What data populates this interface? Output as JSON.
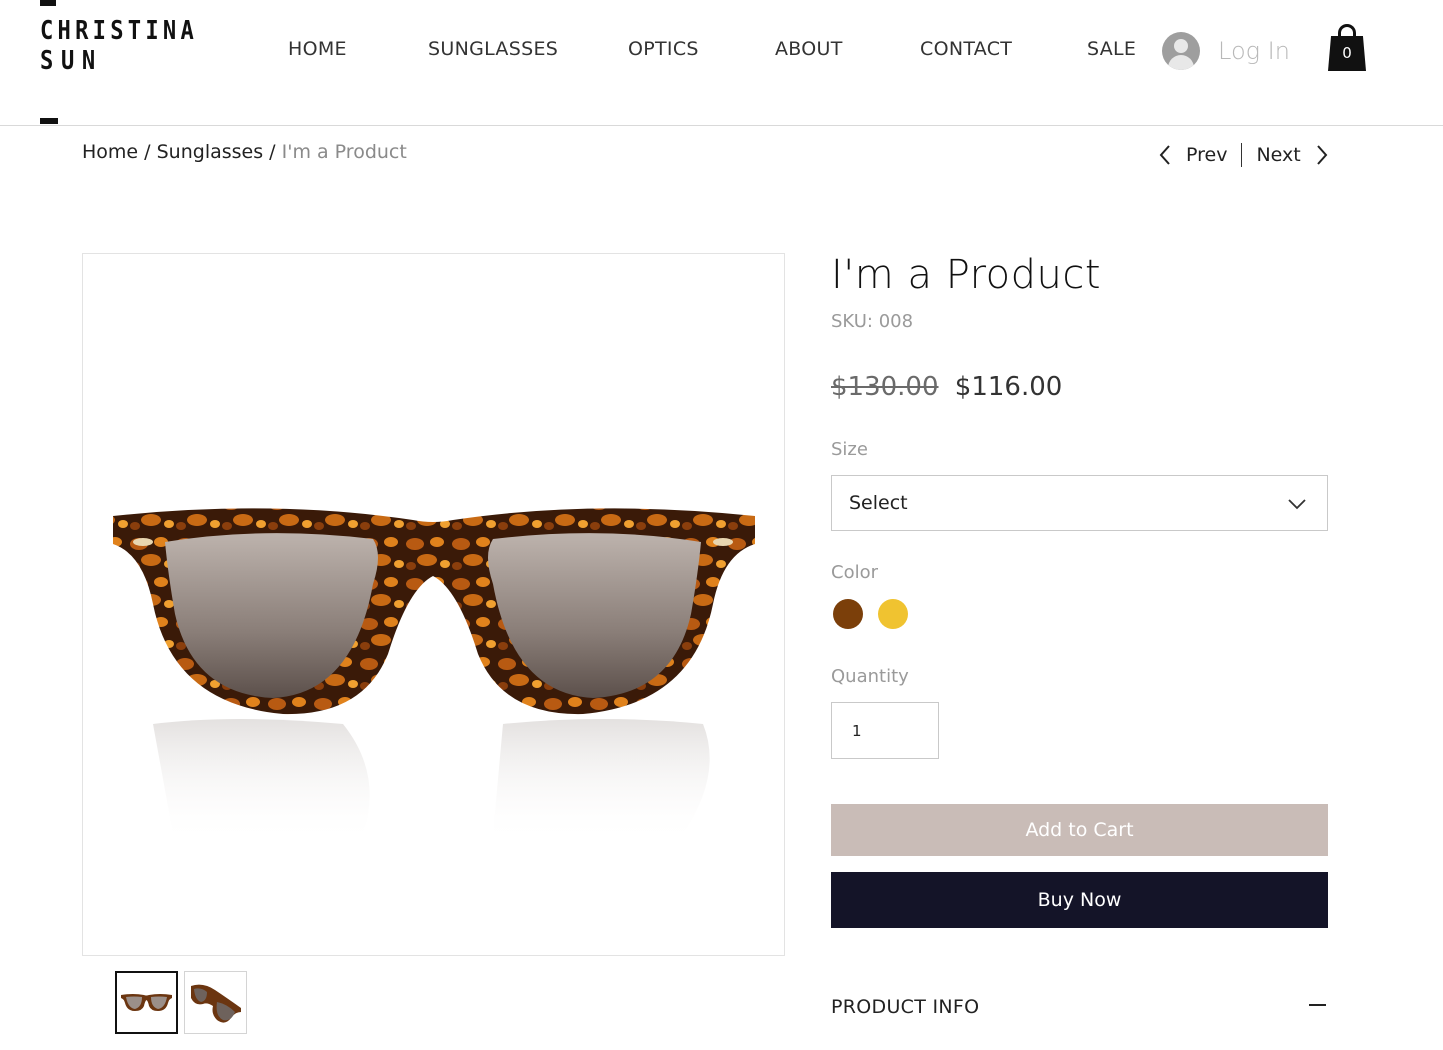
{
  "brand": {
    "line1": "CHRISTINA",
    "line2": "SUN"
  },
  "nav": {
    "items": [
      {
        "label": "HOME"
      },
      {
        "label": "SUNGLASSES"
      },
      {
        "label": "OPTICS"
      },
      {
        "label": "ABOUT"
      },
      {
        "label": "CONTACT"
      },
      {
        "label": "SALE"
      }
    ],
    "login_label": "Log In",
    "cart_count": "0"
  },
  "breadcrumb": {
    "home": "Home",
    "category": "Sunglasses",
    "separator": "/",
    "current": "I'm a Product"
  },
  "pager": {
    "prev": "Prev",
    "next": "Next"
  },
  "product": {
    "title": "I'm a Product",
    "sku": "SKU: 008",
    "price_original": "$130.00",
    "price_sale": "$116.00",
    "size_label": "Size",
    "size_value": "Select",
    "color_label": "Color",
    "colors": [
      "#7b3f0a",
      "#f0c330"
    ],
    "quantity_label": "Quantity",
    "quantity_value": "1",
    "add_to_cart": "Add to Cart",
    "buy_now": "Buy Now",
    "info_title": "PRODUCT INFO"
  },
  "icons": {
    "user": "user-avatar-icon",
    "cart": "shopping-bag-icon",
    "prev": "chevron-left-icon",
    "next": "chevron-right-icon",
    "dropdown": "chevron-down-icon",
    "collapse": "minus-icon"
  }
}
